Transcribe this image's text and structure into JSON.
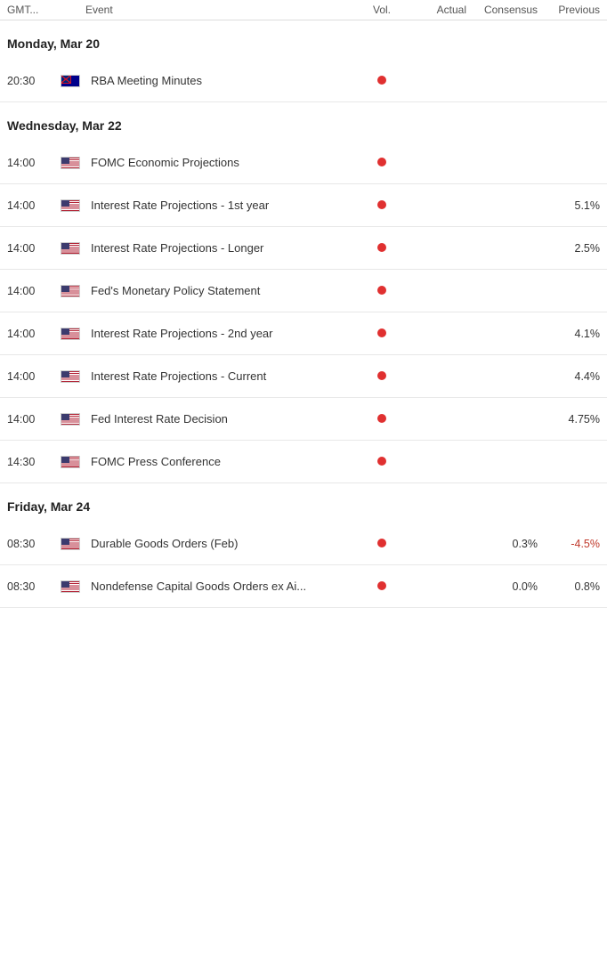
{
  "header": {
    "gmt_label": "GMT...",
    "event_label": "Event",
    "vol_label": "Vol.",
    "actual_label": "Actual",
    "consensus_label": "Consensus",
    "previous_label": "Previous"
  },
  "groups": [
    {
      "date": "Monday, Mar 20",
      "events": [
        {
          "time": "20:30",
          "flag": "au",
          "name": "RBA Meeting Minutes",
          "has_dot": true,
          "actual": "",
          "consensus": "",
          "previous": ""
        }
      ]
    },
    {
      "date": "Wednesday, Mar 22",
      "events": [
        {
          "time": "14:00",
          "flag": "us",
          "name": "FOMC Economic Projections",
          "has_dot": true,
          "actual": "",
          "consensus": "",
          "previous": ""
        },
        {
          "time": "14:00",
          "flag": "us",
          "name": "Interest Rate Projections - 1st year",
          "has_dot": true,
          "actual": "",
          "consensus": "",
          "previous": "5.1%"
        },
        {
          "time": "14:00",
          "flag": "us",
          "name": "Interest Rate Projections - Longer",
          "has_dot": true,
          "actual": "",
          "consensus": "",
          "previous": "2.5%"
        },
        {
          "time": "14:00",
          "flag": "us",
          "name": "Fed's Monetary Policy Statement",
          "has_dot": true,
          "actual": "",
          "consensus": "",
          "previous": ""
        },
        {
          "time": "14:00",
          "flag": "us",
          "name": "Interest Rate Projections - 2nd year",
          "has_dot": true,
          "actual": "",
          "consensus": "",
          "previous": "4.1%"
        },
        {
          "time": "14:00",
          "flag": "us",
          "name": "Interest Rate Projections - Current",
          "has_dot": true,
          "actual": "",
          "consensus": "",
          "previous": "4.4%"
        },
        {
          "time": "14:00",
          "flag": "us",
          "name": "Fed Interest Rate Decision",
          "has_dot": true,
          "actual": "",
          "consensus": "",
          "previous": "4.75%"
        },
        {
          "time": "14:30",
          "flag": "us",
          "name": "FOMC Press Conference",
          "has_dot": true,
          "actual": "",
          "consensus": "",
          "previous": ""
        }
      ]
    },
    {
      "date": "Friday, Mar 24",
      "events": [
        {
          "time": "08:30",
          "flag": "us",
          "name": "Durable Goods Orders (Feb)",
          "has_dot": true,
          "actual": "",
          "consensus": "0.3%",
          "previous": "-4.5%",
          "previous_negative": true
        },
        {
          "time": "08:30",
          "flag": "us",
          "name": "Nondefense Capital Goods Orders ex Ai...",
          "has_dot": true,
          "actual": "",
          "consensus": "0.0%",
          "previous": "0.8%"
        }
      ]
    }
  ]
}
